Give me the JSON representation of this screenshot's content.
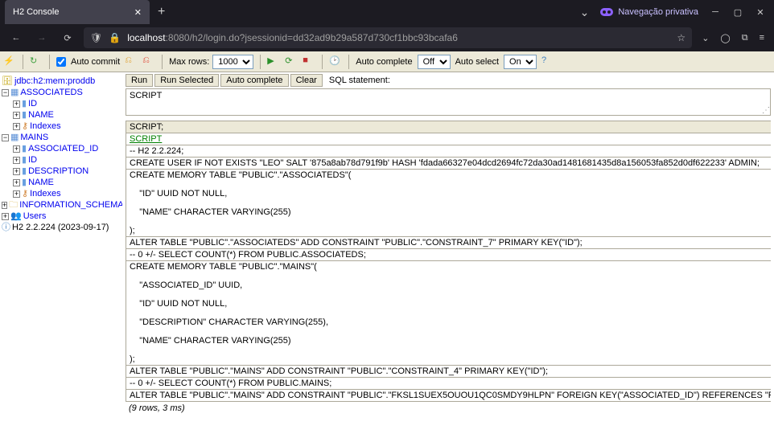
{
  "browser": {
    "tab_title": "H2 Console",
    "private_label": "Navegação privativa",
    "url_host": "localhost",
    "url_port_path": ":8080/h2/login.do?jsessionid=dd32ad9b29a587d730cf1bbc93bcafa6"
  },
  "toolbar": {
    "autocommit": "Auto commit",
    "maxrows_label": "Max rows:",
    "maxrows_value": "1000",
    "autocomplete_label": "Auto complete",
    "autocomplete_value": "Off",
    "autoselect_label": "Auto select",
    "autoselect_value": "On"
  },
  "buttons": {
    "run": "Run",
    "run_selected": "Run Selected",
    "auto_complete": "Auto complete",
    "clear": "Clear",
    "sql_statement": "SQL statement:"
  },
  "sql_input": "SCRIPT",
  "tree": {
    "db": "jdbc:h2:mem:proddb",
    "t1": "ASSOCIATEDS",
    "t1_c1": "ID",
    "t1_c2": "NAME",
    "t1_idx": "Indexes",
    "t2": "MAINS",
    "t2_c1": "ASSOCIATED_ID",
    "t2_c2": "ID",
    "t2_c3": "DESCRIPTION",
    "t2_c4": "NAME",
    "t2_idx": "Indexes",
    "schema": "INFORMATION_SCHEMA",
    "users": "Users",
    "version": "H2 2.2.224 (2023-09-17)"
  },
  "results": {
    "header": "SCRIPT;",
    "link": "SCRIPT",
    "rows": [
      "-- H2 2.2.224;",
      "CREATE USER IF NOT EXISTS \"LEO\" SALT '875a8ab78d791f9b' HASH 'fdada66327e04dcd2694fc72da30ad1481681435d8a156053fa852d0df622233' ADMIN;",
      "CREATE MEMORY TABLE \"PUBLIC\".\"ASSOCIATEDS\"(",
      "    \"ID\" UUID NOT NULL,",
      "    \"NAME\" CHARACTER VARYING(255)",
      ");",
      "ALTER TABLE \"PUBLIC\".\"ASSOCIATEDS\" ADD CONSTRAINT \"PUBLIC\".\"CONSTRAINT_7\" PRIMARY KEY(\"ID\");",
      "-- 0 +/- SELECT COUNT(*) FROM PUBLIC.ASSOCIATEDS;",
      "CREATE MEMORY TABLE \"PUBLIC\".\"MAINS\"(",
      "    \"ASSOCIATED_ID\" UUID,",
      "    \"ID\" UUID NOT NULL,",
      "    \"DESCRIPTION\" CHARACTER VARYING(255),",
      "    \"NAME\" CHARACTER VARYING(255)",
      ");",
      "ALTER TABLE \"PUBLIC\".\"MAINS\" ADD CONSTRAINT \"PUBLIC\".\"CONSTRAINT_4\" PRIMARY KEY(\"ID\");",
      "-- 0 +/- SELECT COUNT(*) FROM PUBLIC.MAINS;",
      "ALTER TABLE \"PUBLIC\".\"MAINS\" ADD CONSTRAINT \"PUBLIC\".\"FKSL1SUEX5OUOU1QC0SMDY9HLPN\" FOREIGN KEY(\"ASSOCIATED_ID\") REFERENCES \"PUBLIC\".\"ASSOCIATEDS\"(\"ID\") NOCHECK;"
    ],
    "status": "(9 rows, 3 ms)"
  }
}
